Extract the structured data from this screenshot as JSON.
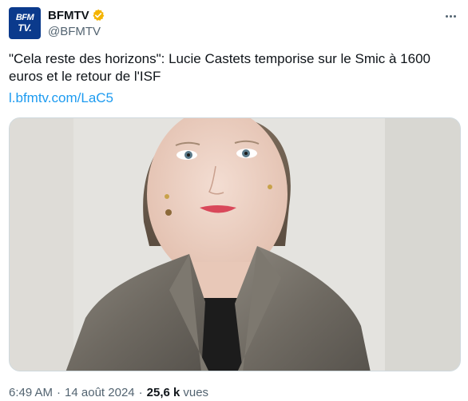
{
  "account": {
    "display_name": "BFMTV",
    "handle": "@BFMTV",
    "avatar_text_top": "BFM",
    "avatar_text_bottom": "TV.",
    "verified_badge_color": "#f4b400"
  },
  "tweet": {
    "text": "\"Cela reste des horizons\": Lucie Castets temporise sur le Smic à 1600 euros et le retour de l'ISF",
    "link": "l.bfmtv.com/LaC5"
  },
  "media": {
    "icon": "photo-portrait"
  },
  "meta": {
    "time": "6:49 AM",
    "date": "14 août 2024",
    "separator": "·",
    "views_count": "25,6 k",
    "views_label": "vues"
  },
  "colors": {
    "link": "#1d9bf0",
    "secondary_text": "#536471",
    "primary_text": "#0f1419"
  }
}
